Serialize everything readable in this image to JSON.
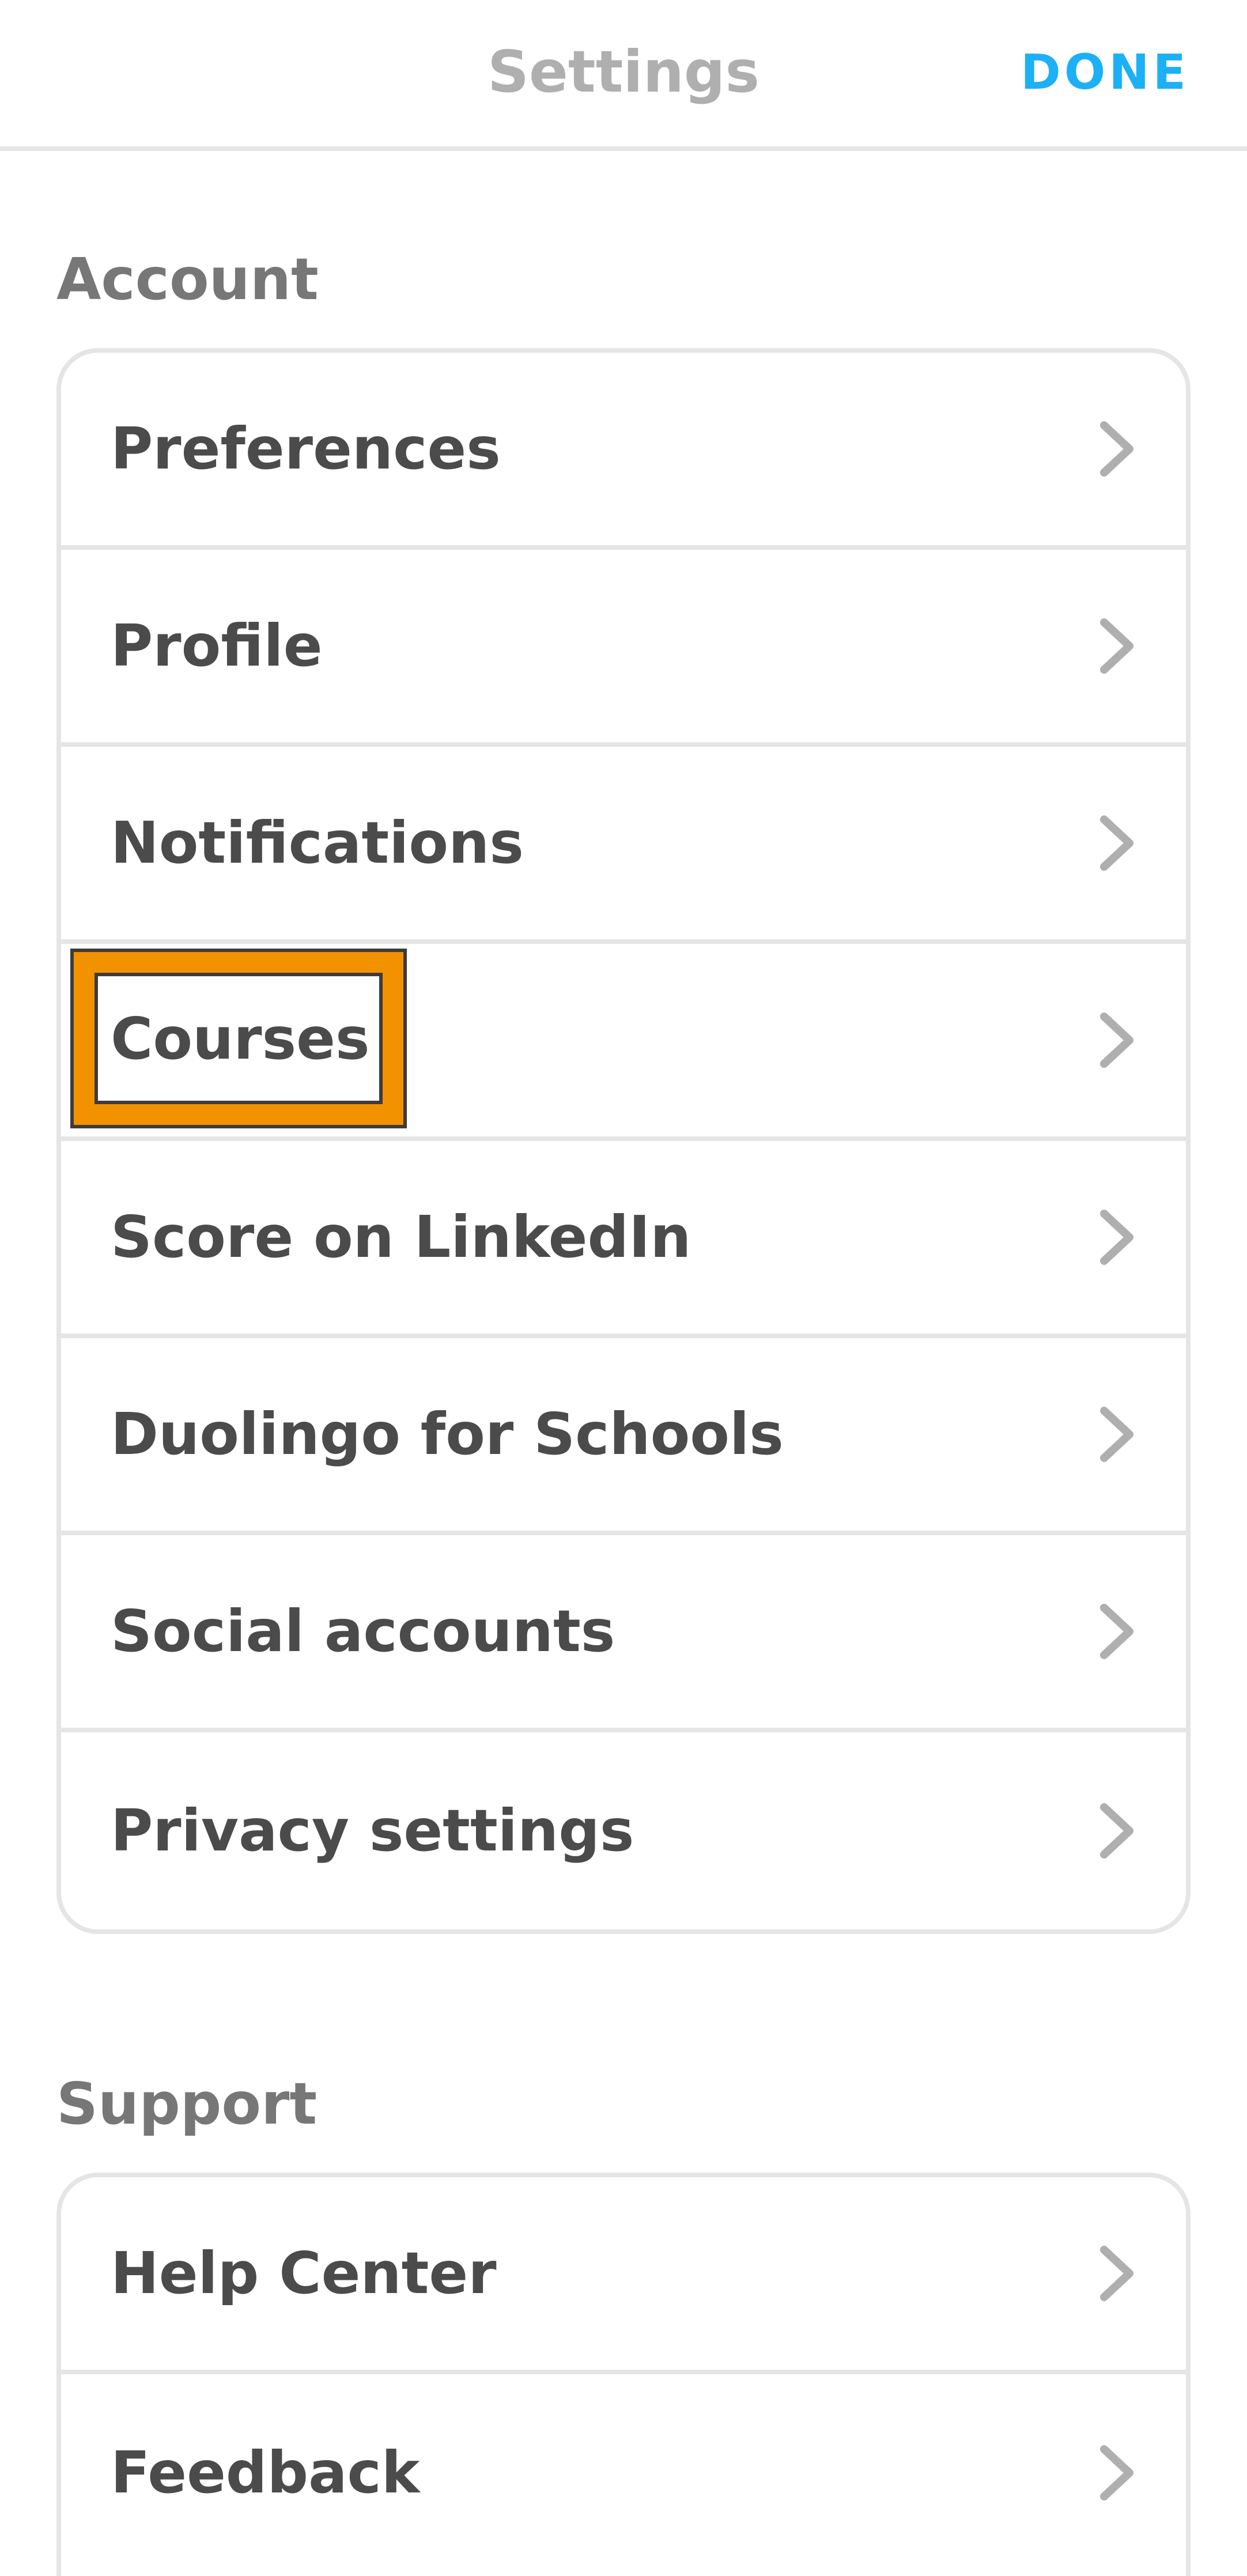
{
  "header": {
    "title": "Settings",
    "done_label": "DONE"
  },
  "sections": {
    "account": {
      "title": "Account",
      "items": [
        {
          "label": "Preferences"
        },
        {
          "label": "Profile"
        },
        {
          "label": "Notifications"
        },
        {
          "label": "Courses"
        },
        {
          "label": "Score on LinkedIn"
        },
        {
          "label": "Duolingo for Schools"
        },
        {
          "label": "Social accounts"
        },
        {
          "label": "Privacy settings"
        }
      ]
    },
    "support": {
      "title": "Support",
      "items": [
        {
          "label": "Help Center"
        },
        {
          "label": "Feedback"
        }
      ]
    }
  },
  "icons": {
    "row_chevron": "chevron-right-icon"
  },
  "colors": {
    "accent": "#1cb0f6",
    "title_gray": "#afafaf",
    "section_gray": "#777777",
    "text": "#4b4b4b",
    "divider": "#e5e5e5",
    "chevron": "#afafaf",
    "highlight": "#f29200"
  }
}
